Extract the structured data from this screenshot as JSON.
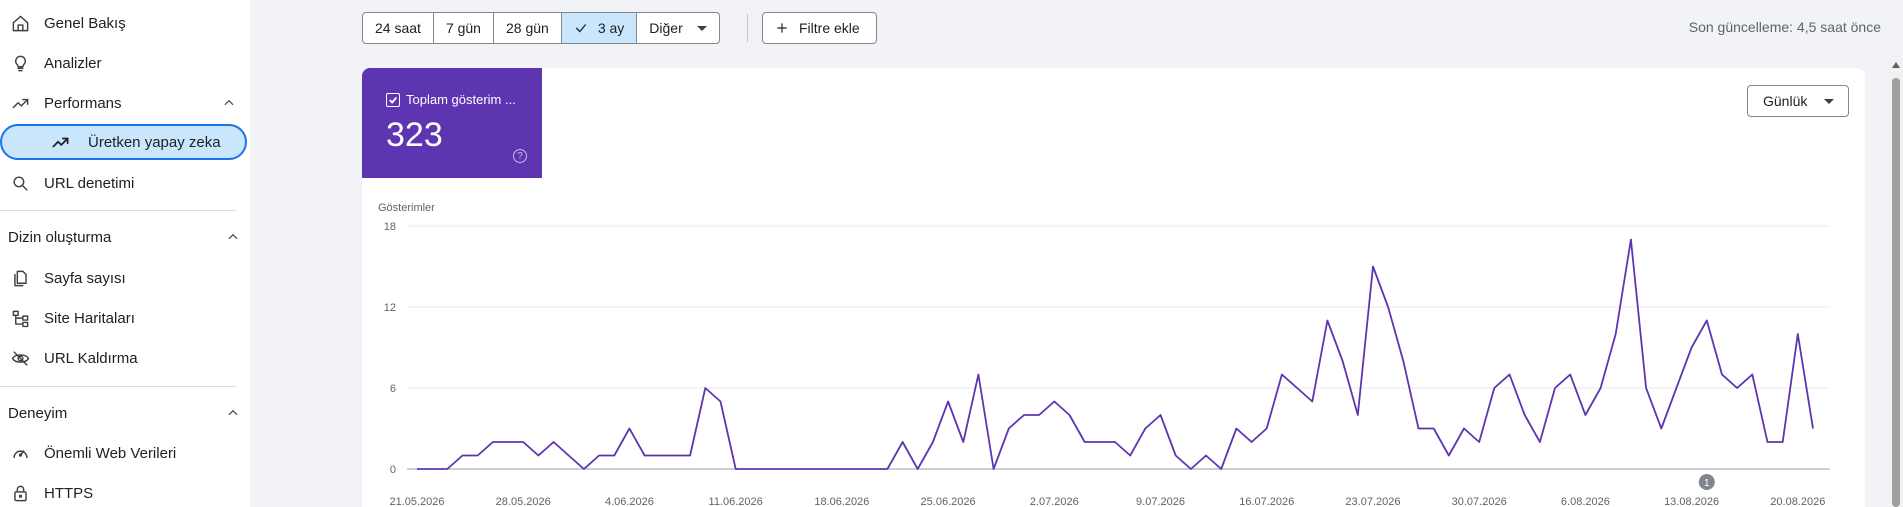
{
  "sidebar": {
    "items": [
      {
        "label": "Genel Bakış",
        "icon": "home-icon"
      },
      {
        "label": "Analizler",
        "icon": "lightbulb-icon"
      },
      {
        "label": "Performans",
        "icon": "trending-up-icon"
      },
      {
        "label": "Üretken yapay zeka",
        "icon": "trending-up-icon"
      },
      {
        "label": "URL denetimi",
        "icon": "search-icon"
      }
    ],
    "sections": [
      {
        "title": "Dizin oluşturma",
        "items": [
          {
            "label": "Sayfa sayısı",
            "icon": "pages-icon"
          },
          {
            "label": "Site Haritaları",
            "icon": "sitemap-icon"
          },
          {
            "label": "URL Kaldırma",
            "icon": "eye-off-icon"
          }
        ]
      },
      {
        "title": "Deneyim",
        "items": [
          {
            "label": "Önemli Web Verileri",
            "icon": "speedometer-icon"
          },
          {
            "label": "HTTPS",
            "icon": "lock-icon"
          }
        ]
      }
    ]
  },
  "toolbar": {
    "ranges": [
      "24 saat",
      "7 gün",
      "28 gün",
      "3 ay",
      "Diğer"
    ],
    "selected_range": "3 ay",
    "add_filter": "Filtre ekle",
    "last_update": "Son güncelleme: 4,5 saat önce"
  },
  "metric": {
    "label": "Toplam gösterim ...",
    "value": "323",
    "help": "?",
    "color": "#5e35b1"
  },
  "granularity": "Günlük",
  "chart_data": {
    "type": "line",
    "ylabel": "Gösterimler",
    "ylim": [
      0,
      18
    ],
    "yticks": [
      "18",
      "12",
      "6",
      "0"
    ],
    "series_color": "#5e35b1",
    "x_tick_labels": [
      "21.05.2026",
      "28.05.2026",
      "4.06.2026",
      "11.06.2026",
      "18.06.2026",
      "25.06.2026",
      "2.07.2026",
      "9.07.2026",
      "16.07.2026",
      "23.07.2026",
      "30.07.2026",
      "6.08.2026",
      "13.08.2026",
      "20.08.2026"
    ],
    "annotation": {
      "label": "1",
      "date": "14.08.2026"
    },
    "values": [
      0,
      0,
      0,
      1,
      1,
      2,
      2,
      2,
      1,
      2,
      1,
      0,
      1,
      1,
      3,
      1,
      1,
      1,
      1,
      6,
      5,
      0,
      0,
      0,
      0,
      0,
      0,
      0,
      0,
      0,
      0,
      0,
      2,
      0,
      2,
      5,
      2,
      7,
      0,
      3,
      4,
      4,
      5,
      4,
      2,
      2,
      2,
      1,
      3,
      4,
      1,
      0,
      1,
      0,
      3,
      2,
      3,
      7,
      6,
      5,
      11,
      8,
      4,
      15,
      12,
      8,
      3,
      3,
      1,
      3,
      2,
      6,
      7,
      4,
      2,
      6,
      7,
      4,
      6,
      10,
      17,
      6,
      3,
      6,
      9,
      11,
      7,
      6,
      7,
      2,
      2,
      10,
      3
    ]
  }
}
